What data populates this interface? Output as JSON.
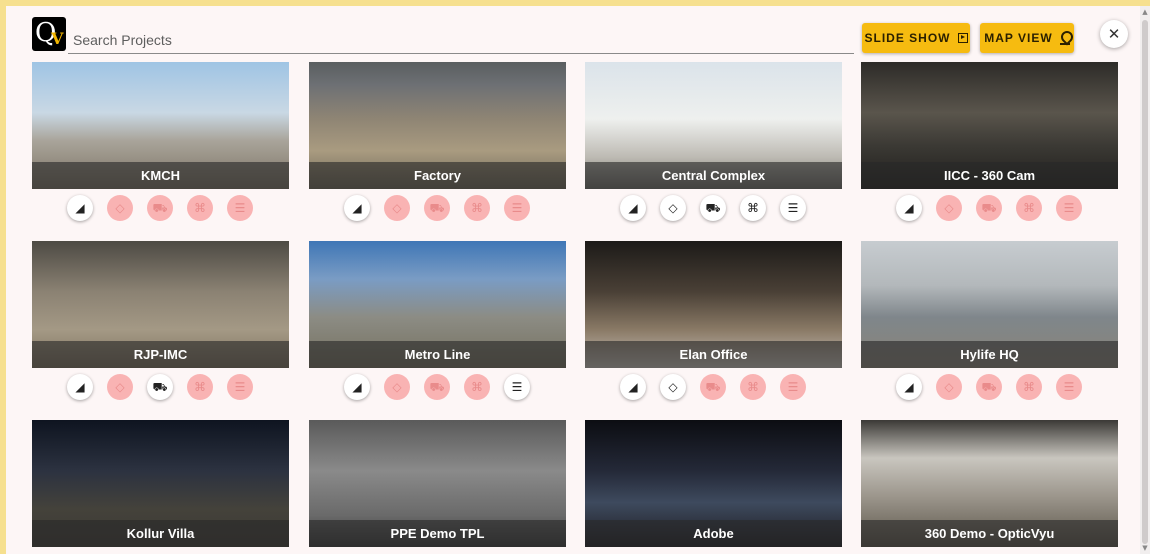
{
  "search": {
    "placeholder": "Search Projects"
  },
  "buttons": {
    "slide_show": "SLIDE SHOW",
    "map_view": "MAP VIEW",
    "close": "✕"
  },
  "logo": {
    "q": "Q",
    "v": "V"
  },
  "icon_glyphs": {
    "camera": "◢",
    "timelapse": "◇",
    "truck": "⛟",
    "drone": "⌘",
    "menu": "☰"
  },
  "projects": [
    {
      "name": "KMCH",
      "features": {
        "camera": true,
        "timelapse": false,
        "truck": false,
        "drone": false,
        "menu": false
      }
    },
    {
      "name": "Factory",
      "features": {
        "camera": true,
        "timelapse": false,
        "truck": false,
        "drone": false,
        "menu": false
      }
    },
    {
      "name": "Central Complex",
      "features": {
        "camera": true,
        "timelapse": true,
        "truck": true,
        "drone": true,
        "menu": true
      }
    },
    {
      "name": "IICC - 360 Cam",
      "features": {
        "camera": true,
        "timelapse": false,
        "truck": false,
        "drone": false,
        "menu": false
      }
    },
    {
      "name": "RJP-IMC",
      "features": {
        "camera": true,
        "timelapse": false,
        "truck": true,
        "drone": false,
        "menu": false
      }
    },
    {
      "name": "Metro Line",
      "features": {
        "camera": true,
        "timelapse": false,
        "truck": false,
        "drone": false,
        "menu": true
      }
    },
    {
      "name": "Elan Office",
      "features": {
        "camera": true,
        "timelapse": true,
        "truck": false,
        "drone": false,
        "menu": false
      }
    },
    {
      "name": "Hylife HQ",
      "features": {
        "camera": true,
        "timelapse": false,
        "truck": false,
        "drone": false,
        "menu": false
      }
    },
    {
      "name": "Kollur Villa",
      "features": {}
    },
    {
      "name": "PPE Demo TPL",
      "features": {}
    },
    {
      "name": "Adobe",
      "features": {}
    },
    {
      "name": "360 Demo - OpticVyu",
      "features": {}
    }
  ]
}
